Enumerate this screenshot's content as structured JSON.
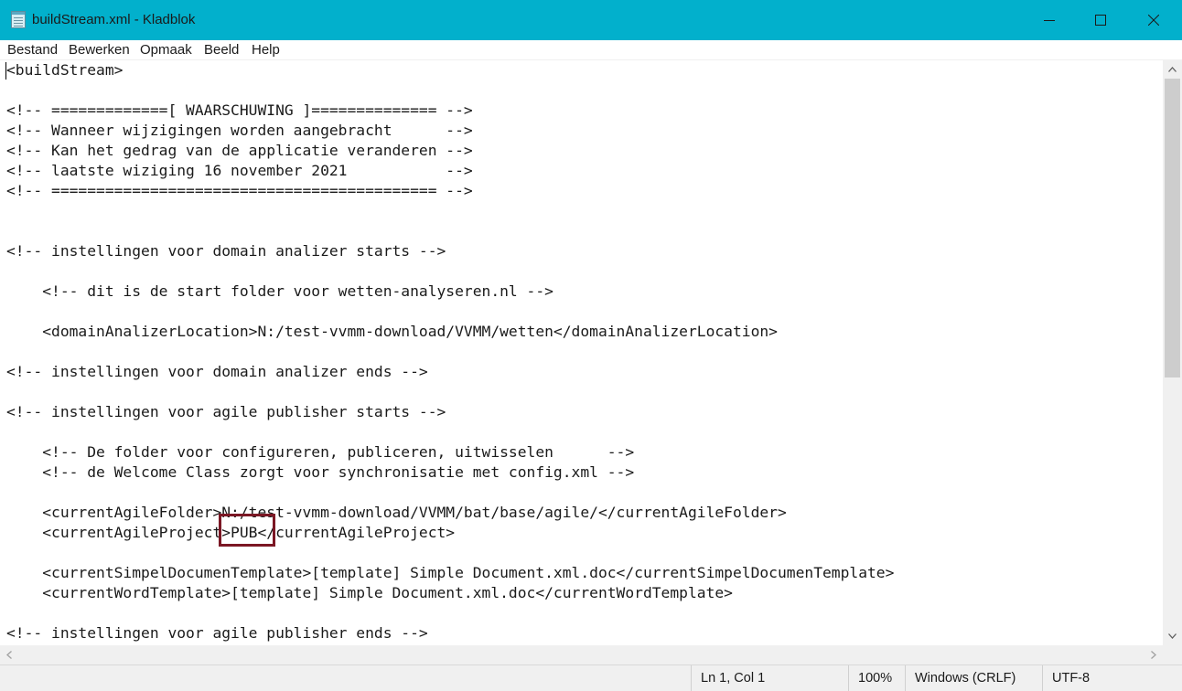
{
  "window": {
    "title": "buildStream.xml - Kladblok",
    "icon": "notepad-icon",
    "accent_color": "#02b0cc"
  },
  "menu": {
    "items": [
      "Bestand",
      "Bewerken",
      "Opmaak",
      "Beeld",
      "Help"
    ]
  },
  "editor": {
    "lines": [
      "<buildStream>",
      "",
      "<!-- =============[ WAARSCHUWING ]============== -->",
      "<!-- Wanneer wijzigingen worden aangebracht      -->",
      "<!-- Kan het gedrag van de applicatie veranderen -->",
      "<!-- laatste wiziging 16 november 2021           -->",
      "<!-- =========================================== -->",
      "",
      "",
      "<!-- instellingen voor domain analizer starts -->",
      "",
      "    <!-- dit is de start folder voor wetten-analyseren.nl -->",
      "",
      "    <domainAnalizerLocation>N:/test-vvmm-download/VVMM/wetten</domainAnalizerLocation>",
      "",
      "<!-- instellingen voor domain analizer ends -->",
      "",
      "<!-- instellingen voor agile publisher starts -->",
      "",
      "    <!-- De folder voor configureren, publiceren, uitwisselen      -->",
      "    <!-- de Welcome Class zorgt voor synchronisatie met config.xml -->",
      "",
      "    <currentAgileFolder>N:/test-vvmm-download/VVMM/bat/base/agile/</currentAgileFolder>",
      "    <currentAgileProject>PUB</currentAgileProject>",
      "",
      "    <currentSimpelDocumenTemplate>[template] Simple Document.xml.doc</currentSimpelDocumenTemplate>",
      "    <currentWordTemplate>[template] Simple Document.xml.doc</currentWordTemplate>",
      "",
      "<!-- instellingen voor agile publisher ends -->"
    ],
    "highlight_color": "#7b1724"
  },
  "status": {
    "position": "Ln 1, Col 1",
    "zoom": "100%",
    "line_ending": "Windows (CRLF)",
    "encoding": "UTF-8"
  }
}
